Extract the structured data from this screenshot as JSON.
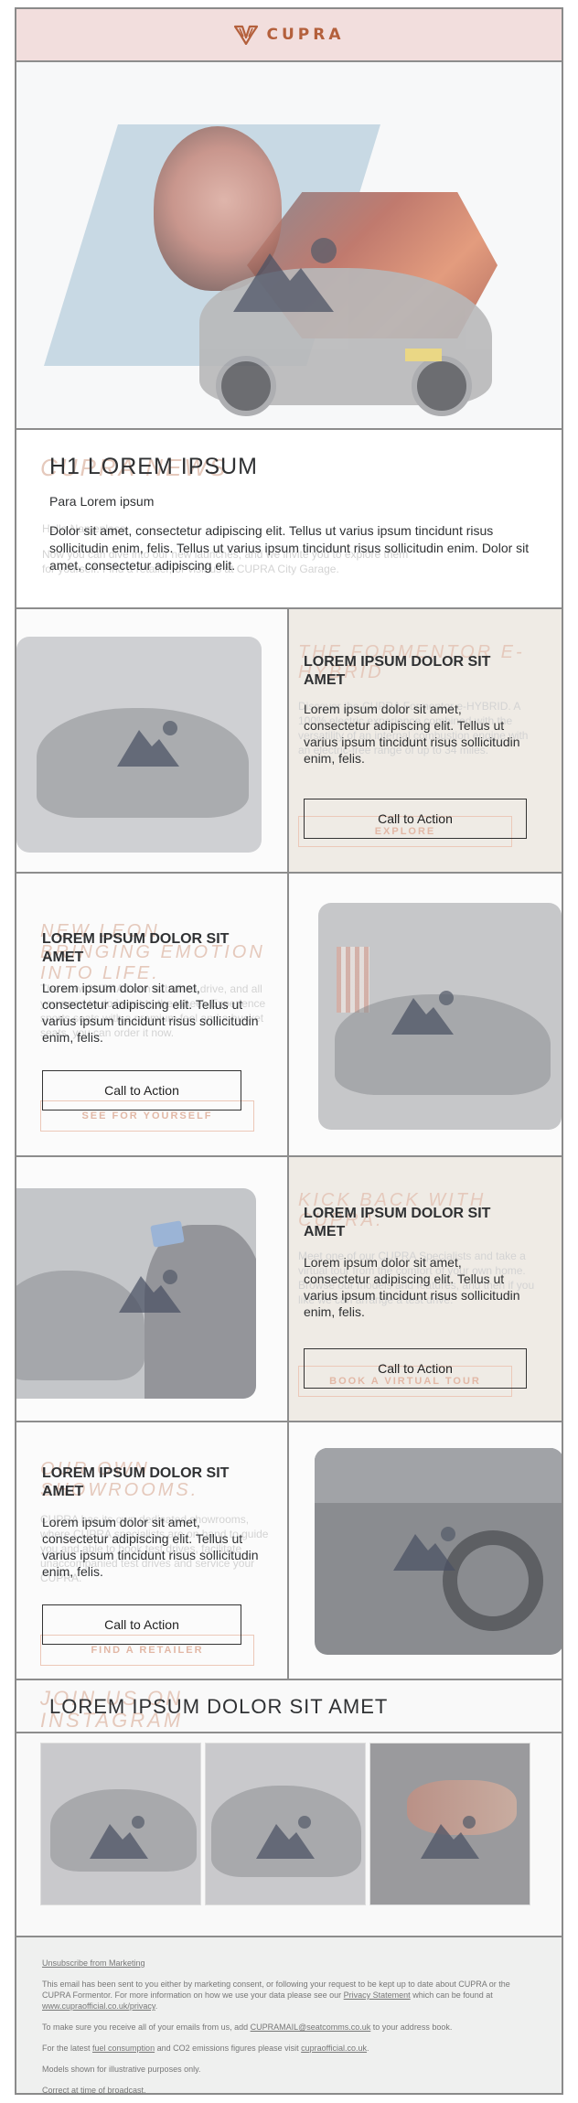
{
  "brand": {
    "logo_text": "CUPRA",
    "accent": "#b4603c",
    "header_bg": "#f2dedd"
  },
  "intro": {
    "ghost_heading": "CUPRA NEWS",
    "h1": "H1 LOREM IPSUM",
    "para_title": "Para Lorem ipsum",
    "body": "Dolor sit amet, consectetur adipiscing elit. Tellus ut varius ipsum tincidunt risus sollicitudin enim, felis. Tellus ut varius ipsum tincidunt risus sollicitudin enim. Dolor sit amet, consectetur adipiscing elit.",
    "ghost_line1": "Hello Nameplace,",
    "ghost_line2": "Now you can dive into our new launches, and we invite you to explore them",
    "ghost_line3": "for yourself. Find a retailer, or visit us at CUPRA City Garage."
  },
  "blocks": [
    {
      "title": "LOREM IPSUM DOLOR SIT AMET",
      "body": "Lorem ipsum dolor sit amet, consectetur adipiscing elit. Tellus ut varius ipsum tincidunt risus sollicitudin enim, felis.",
      "cta": "Call to Action",
      "ghost_heading": "THE FORMENTOR E-HYBRID",
      "ghost_body": "Discover the CUPRA Formentor e-HYBRID. A 100% electric experience combined with the versatility of an internal combustion engine with an electric-free range of up to 34 miles.",
      "ghost_cta": "EXPLORE"
    },
    {
      "title": "LOREM IPSUM DOLOR SIT AMET",
      "body": "Lorem ipsum dolor sit amet, consectetur adipiscing elit. Tellus ut varius ipsum tincidunt risus sollicitudin enim, felis.",
      "cta": "Call to Action",
      "ghost_heading": "NEW LEON. BRINGING EMOTION INTO LIFE.",
      "ghost_body": "The new CUPRA Leon is built to drive, and all you need to do is get to the wheel. Experience sports seats with a premium feel and a bucket seats, you can order it now.",
      "ghost_cta": "SEE FOR YOURSELF"
    },
    {
      "title": "LOREM IPSUM DOLOR SIT AMET",
      "body": "Lorem ipsum dolor sit amet, consectetur adipiscing elit. Tellus ut varius ipsum tincidunt risus sollicitudin enim, felis.",
      "cta": "Call to Action",
      "ghost_heading": "KICK BACK WITH CUPRA.",
      "ghost_body": "Meet one of our CUPRA Specialists and take a virtual tour from the comfort of your own home. Browse our models and features, and then if you like we can arrange a test drive.",
      "ghost_cta": "BOOK A VIRTUAL TOUR"
    },
    {
      "title": "LOREM IPSUM DOLOR SIT AMET",
      "body": "Lorem ipsum dolor sit amet, consectetur adipiscing elit. Tellus ut varius ipsum tincidunt risus sollicitudin enim, felis.",
      "cta": "Call to Action",
      "ghost_heading": "OUR OWN SHOWROOMS.",
      "ghost_body": "CUPRA has its own dedicated showrooms, where CUPRA specialists are on hand to guide you and able to book test drives, facilitate unaccompanied test drives and service your CUPRA.",
      "ghost_cta": "FIND A RETAILER"
    }
  ],
  "instagram": {
    "title": "LOREM IPSUM DOLOR SIT AMET",
    "ghost_heading": "JOIN US ON INSTAGRAM"
  },
  "footer": {
    "unsubscribe": "Unsubscribe from Marketing",
    "p1_a": "This email has been sent to you either by marketing consent, or following your request to be kept up to date about CUPRA or the CUPRA Formentor. For more information on how we use your data please see our ",
    "p1_link": "Privacy Statement",
    "p1_b": " which can be found at ",
    "p1_url": "www.cupraofficial.co.uk/privacy",
    "p1_end": ".",
    "p2_a": "To make sure you receive all of your emails from us, add ",
    "p2_email": "CUPRAMAIL@seatcomms.co.uk",
    "p2_b": " to your address book.",
    "p3_a": "For the latest ",
    "p3_link": "fuel consumption",
    "p3_b": " and CO2 emissions figures please visit ",
    "p3_url": "cupraofficial.co.uk",
    "p3_end": ".",
    "p4": "Models shown for illustrative purposes only.",
    "p5": "Correct at time of broadcast."
  }
}
